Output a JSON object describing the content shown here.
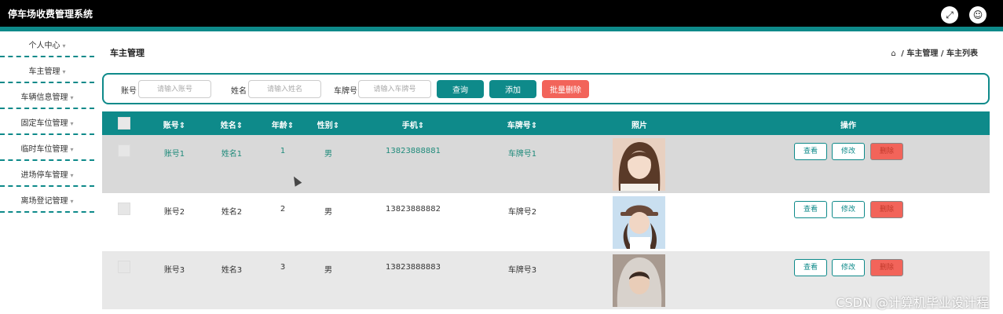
{
  "app": {
    "title": "停车场收费管理系统",
    "fullscreen_icon": "expand-icon",
    "user_icon": "user-icon"
  },
  "sidebar": {
    "items": [
      {
        "label": "个人中心"
      },
      {
        "label": "车主管理"
      },
      {
        "label": "车辆信息管理"
      },
      {
        "label": "固定车位管理"
      },
      {
        "label": "临时车位管理"
      },
      {
        "label": "进场停车管理"
      },
      {
        "label": "离场登记管理"
      }
    ]
  },
  "page": {
    "title": "车主管理",
    "breadcrumb": {
      "home_icon": "home-icon",
      "separator": "/",
      "items": [
        "车主管理",
        "车主列表"
      ]
    }
  },
  "search": {
    "account_label": "账号",
    "account_placeholder": "请输入账号",
    "name_label": "姓名",
    "name_placeholder": "请输入姓名",
    "plate_label": "车牌号",
    "plate_placeholder": "请输入车牌号",
    "query_button": "查询",
    "add_button": "添加",
    "batch_delete_button": "批量删除"
  },
  "table": {
    "columns": [
      "账号",
      "姓名",
      "年龄",
      "性别",
      "手机",
      "车牌号",
      "照片",
      "操作"
    ],
    "sort_icon": "sort-icon",
    "rows": [
      {
        "account": "账号1",
        "name": "姓名1",
        "age": "1",
        "gender": "男",
        "phone": "13823888881",
        "plate": "车牌号1",
        "photo": "portrait-photo"
      },
      {
        "account": "账号2",
        "name": "姓名2",
        "age": "2",
        "gender": "男",
        "phone": "13823888882",
        "plate": "车牌号2",
        "photo": "portrait-photo"
      },
      {
        "account": "账号3",
        "name": "姓名3",
        "age": "3",
        "gender": "男",
        "phone": "13823888883",
        "plate": "车牌号3",
        "photo": "portrait-photo"
      }
    ],
    "actions": {
      "view": "查看",
      "edit": "修改",
      "delete": "删除"
    }
  },
  "watermark": "CSDN @计算机毕业设计程",
  "colors": {
    "accent": "#0e8a8a",
    "danger": "#f2645a",
    "topbar": "#000000"
  }
}
